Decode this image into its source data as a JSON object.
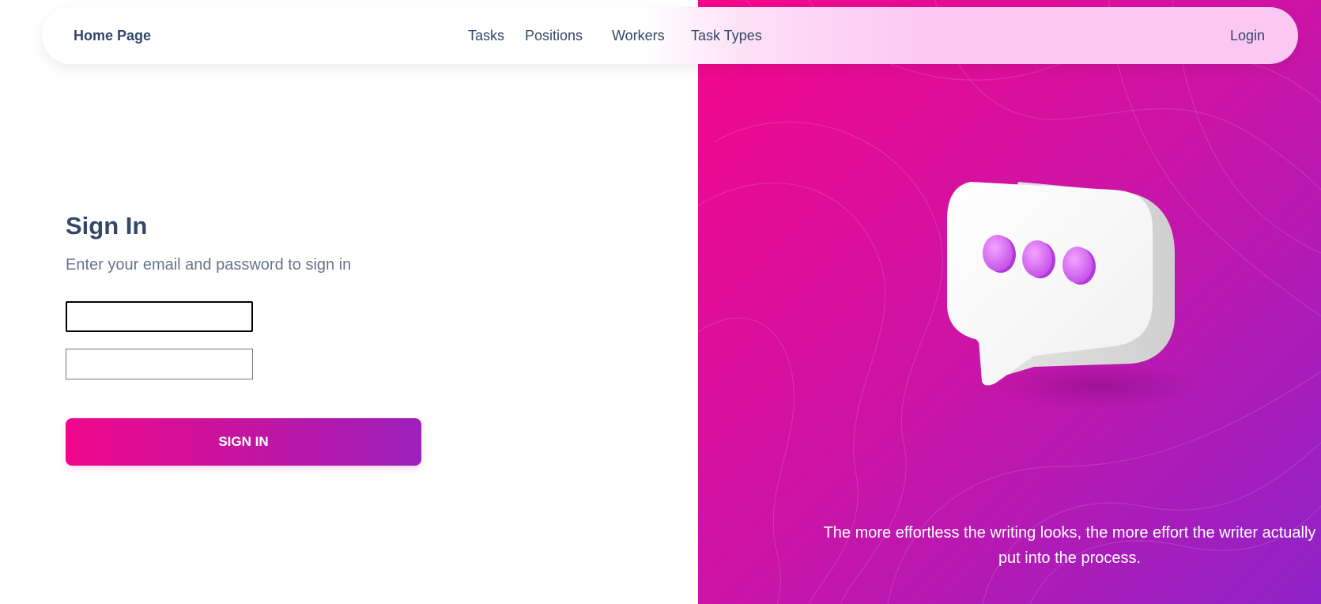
{
  "navbar": {
    "brand": "Home Page",
    "links": [
      "Tasks",
      "Positions",
      "Workers",
      "Task Types"
    ],
    "login": "Login"
  },
  "form": {
    "title": "Sign In",
    "subtitle": "Enter your email and password to sign in",
    "email_value": "",
    "password_value": "",
    "submit_label": "SIGN IN"
  },
  "hero": {
    "quote": "The more effortless the writing looks, the more effort the writer actually put into the process.",
    "illustration": "chat-bubble-icon"
  },
  "colors": {
    "accent_start": "#f5078a",
    "accent_end": "#8e23c8",
    "text_dark": "#344767",
    "text_muted": "#67748e"
  }
}
